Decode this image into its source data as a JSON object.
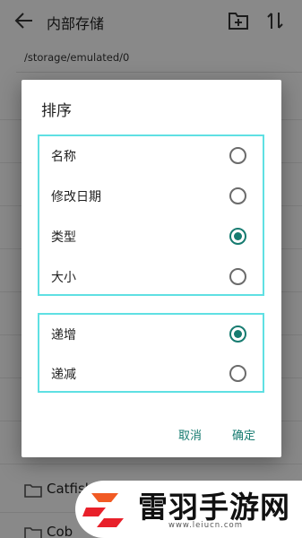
{
  "appbar": {
    "title": "内部存储"
  },
  "path": "/storage/emulated/0",
  "files": [
    "Catfish",
    "Cob"
  ],
  "dialog": {
    "title": "排序",
    "sort_by": [
      {
        "label": "名称",
        "checked": false
      },
      {
        "label": "修改日期",
        "checked": false
      },
      {
        "label": "类型",
        "checked": true
      },
      {
        "label": "大小",
        "checked": false
      }
    ],
    "order": [
      {
        "label": "递增",
        "checked": true
      },
      {
        "label": "递减",
        "checked": false
      }
    ],
    "cancel_label": "取消",
    "ok_label": "确定"
  },
  "watermark": {
    "brand": "雷羽手游网",
    "url": "www.leiucn.com"
  },
  "colors": {
    "accent": "#167b70",
    "highlight_border": "#5fe0e3"
  }
}
